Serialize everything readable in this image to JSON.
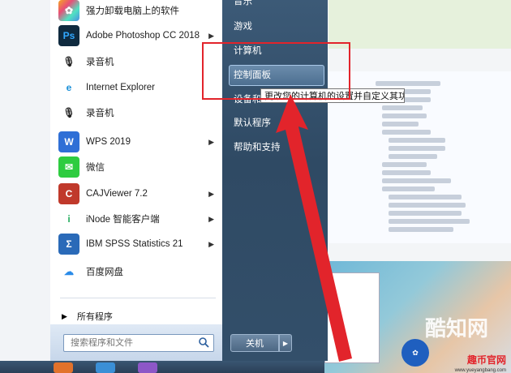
{
  "programs": [
    {
      "label": "强力卸载电脑上的软件",
      "icon": "colorful-flower-icon",
      "has_arrow": false
    },
    {
      "label": "Adobe Photoshop CC 2018",
      "icon": "photoshop-icon",
      "has_arrow": true
    },
    {
      "label": "录音机",
      "icon": "microphone-icon",
      "has_arrow": false
    },
    {
      "label": "Internet Explorer",
      "icon": "internet-explorer-icon",
      "has_arrow": false
    },
    {
      "label": "录音机",
      "icon": "microphone-icon",
      "has_arrow": false
    },
    {
      "label": "WPS 2019",
      "icon": "wps-icon",
      "has_arrow": true
    },
    {
      "label": "微信",
      "icon": "wechat-icon",
      "has_arrow": false
    },
    {
      "label": "CAJViewer 7.2",
      "icon": "cajviewer-icon",
      "has_arrow": true
    },
    {
      "label": "iNode 智能客户端",
      "icon": "inode-icon",
      "has_arrow": true
    },
    {
      "label": "IBM SPSS Statistics 21",
      "icon": "spss-icon",
      "has_arrow": true
    },
    {
      "label": "百度网盘",
      "icon": "baidu-netdisk-icon",
      "has_arrow": false
    }
  ],
  "ps_icon_text": "Ps",
  "wps_icon_text": "W",
  "spss_icon_text": "Σ",
  "all_programs_label": "所有程序",
  "search_placeholder": "搜索程序和文件",
  "right_pane": {
    "items": [
      "音乐",
      "游戏",
      "计算机",
      "控制面板",
      "设备和",
      "默认程序",
      "帮助和支持"
    ],
    "highlighted_index": 3,
    "shutdown_label": "关机"
  },
  "tooltip": "更改您的计算机的设置并自定义其功能。",
  "colors": {
    "annotation_red": "#e2242b",
    "right_pane_bg": "#2f4a64",
    "highlight_border": "#a9c8e8"
  },
  "watermark": {
    "brand_primary": "酷知网",
    "brand_secondary": "趣币官网",
    "domain": "www.yueyangbang.com"
  }
}
